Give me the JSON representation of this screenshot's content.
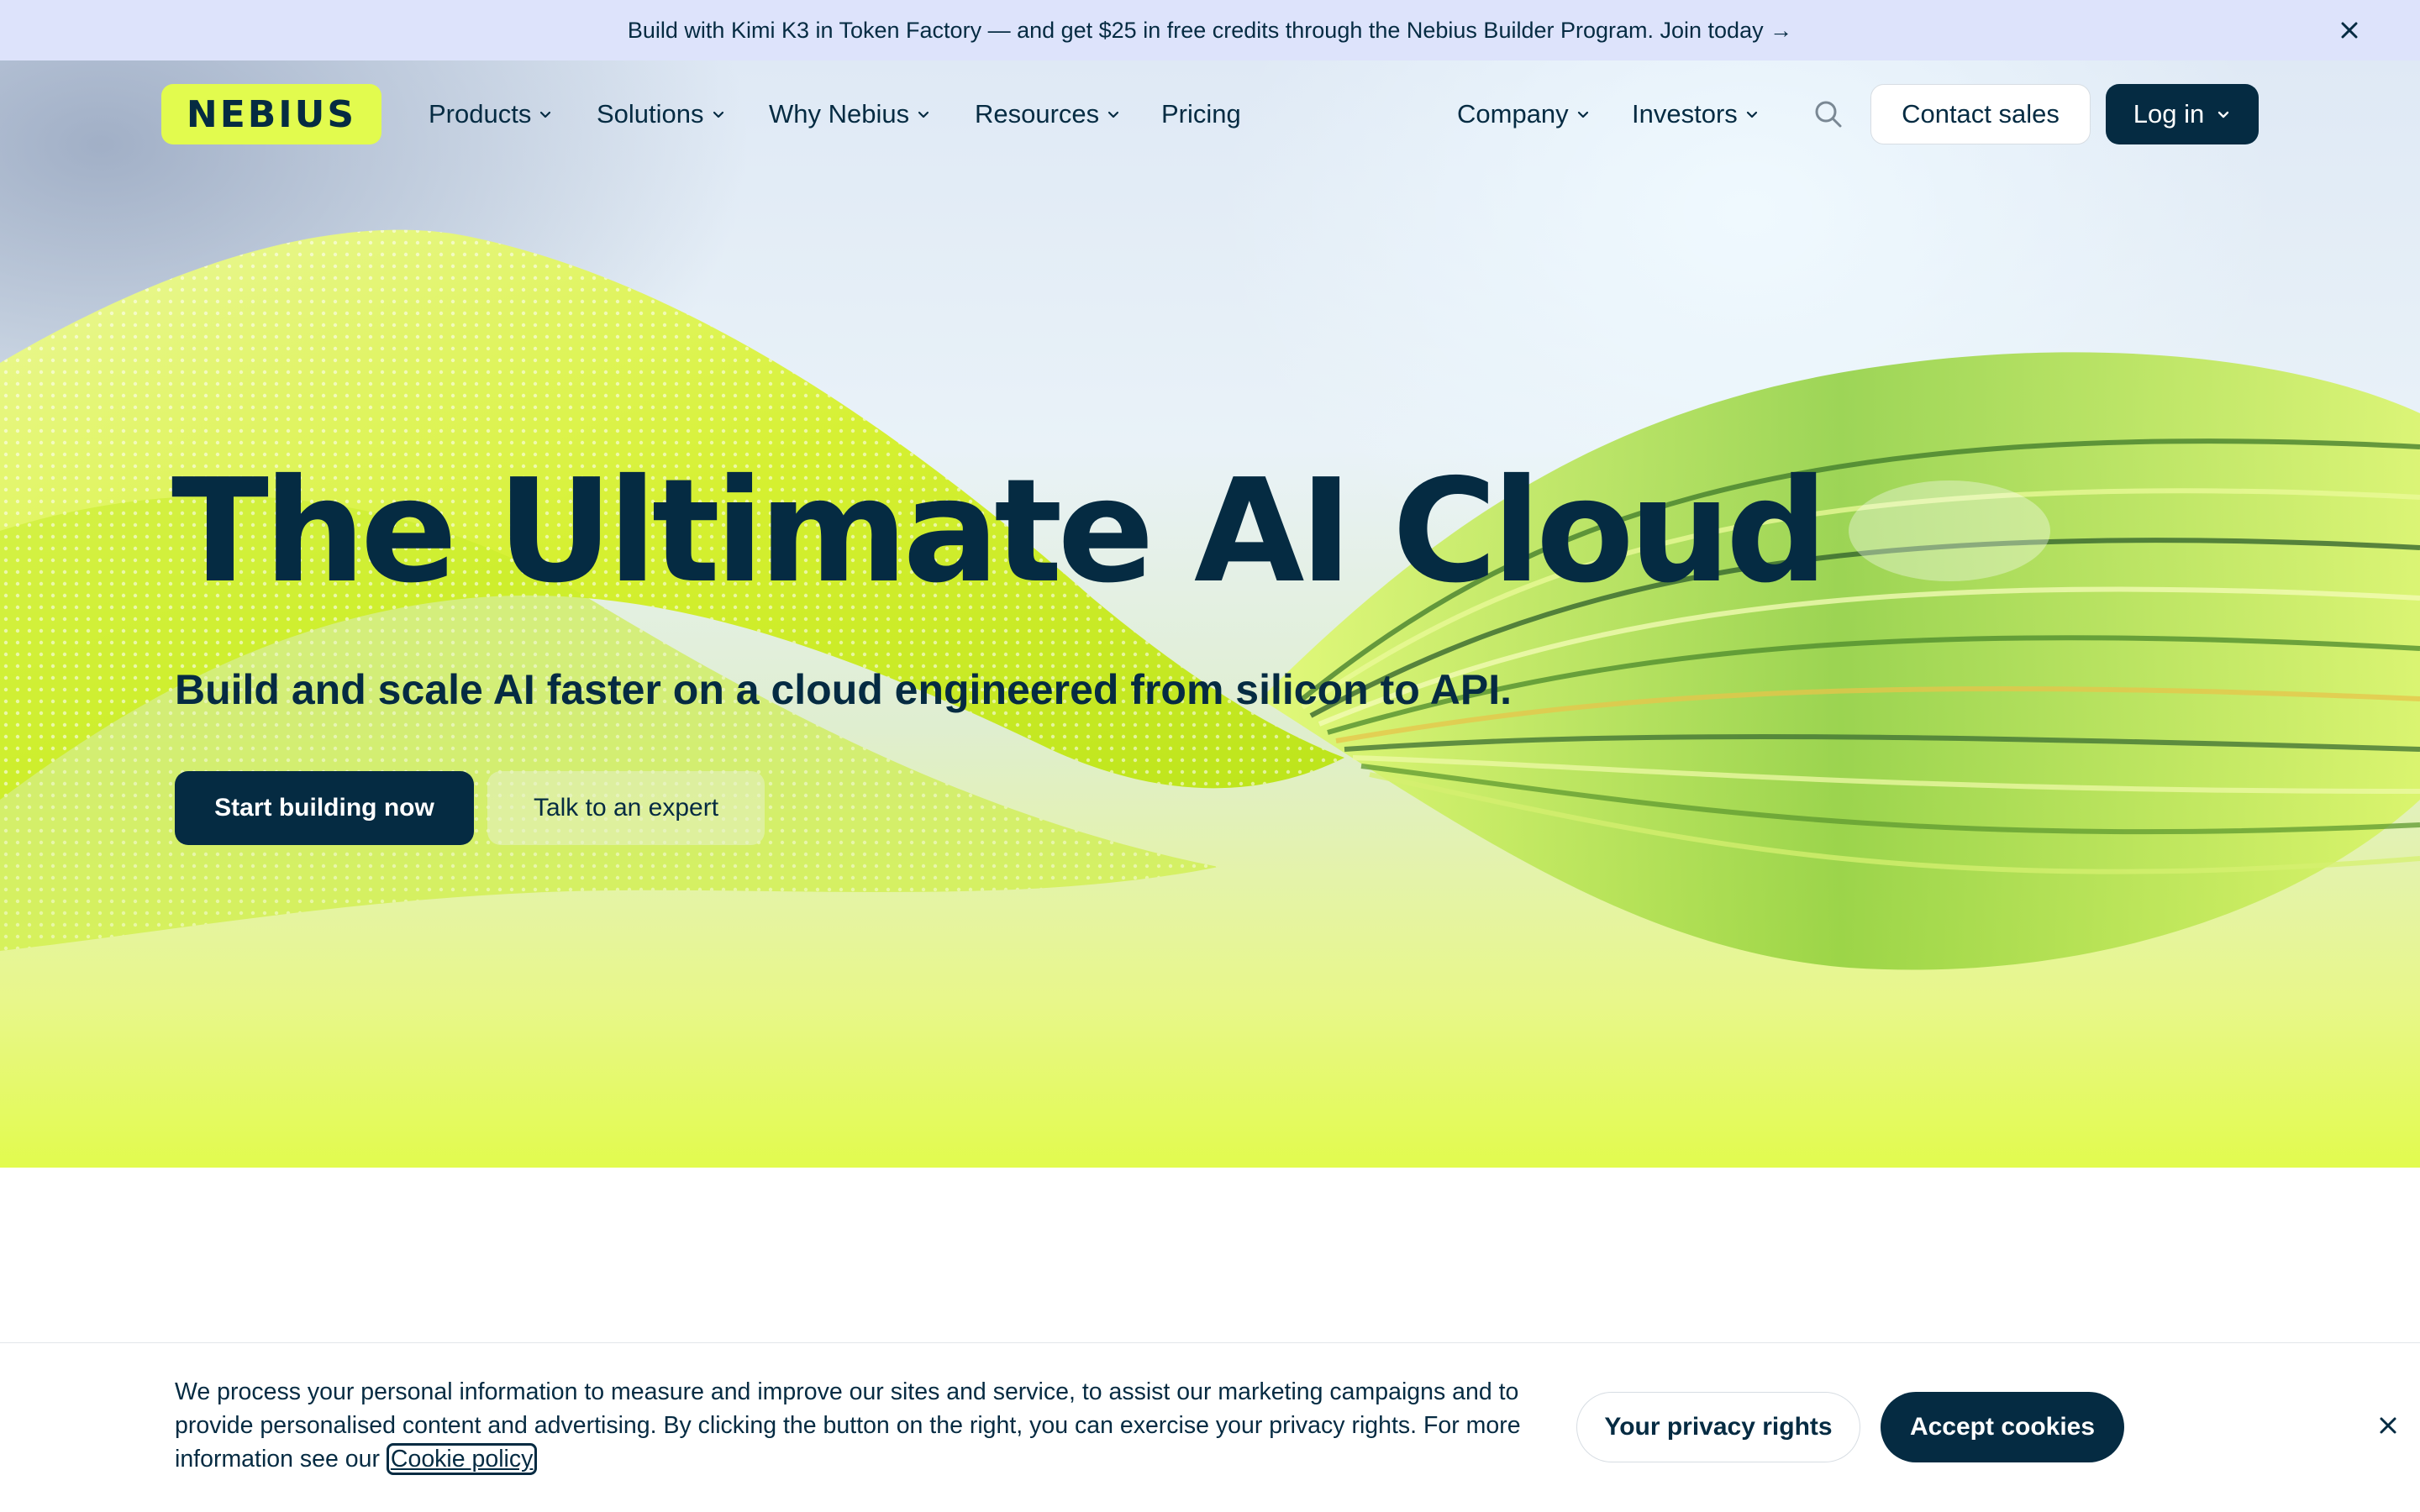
{
  "announcement": {
    "text": "Build with Kimi K3 in Token Factory — and get $25 in free credits through the Nebius Builder Program. Join today →",
    "close_icon": "close-icon"
  },
  "nav": {
    "logo": "NEBIUS",
    "items": [
      {
        "label": "Products",
        "has_dropdown": true
      },
      {
        "label": "Solutions",
        "has_dropdown": true
      },
      {
        "label": "Why Nebius",
        "has_dropdown": true
      },
      {
        "label": "Resources",
        "has_dropdown": true
      },
      {
        "label": "Pricing",
        "has_dropdown": false
      },
      {
        "label": "Company",
        "has_dropdown": true
      },
      {
        "label": "Investors",
        "has_dropdown": true
      }
    ],
    "search_icon": "search-icon",
    "contact_label": "Contact sales",
    "login_label": "Log in"
  },
  "hero": {
    "title": "The Ultimate AI Cloud",
    "subtitle": "Build and scale AI faster on a cloud engineered from silicon to API.",
    "primary_cta": "Start building now",
    "secondary_cta": "Talk to an expert"
  },
  "cookie": {
    "text": "We process your personal information to measure and improve our sites and service, to assist our marketing campaigns and to provide personalised content and advertising. By clicking the button on the right, you can exercise your privacy rights. For more information see our",
    "link_label": "Cookie policy",
    "privacy_label": "Your privacy rights",
    "accept_label": "Accept cookies",
    "close_icon": "close-icon"
  },
  "colors": {
    "brand_lime": "#e2fb4e",
    "navy": "#052b42",
    "announce_bg": "#dde3fb"
  }
}
